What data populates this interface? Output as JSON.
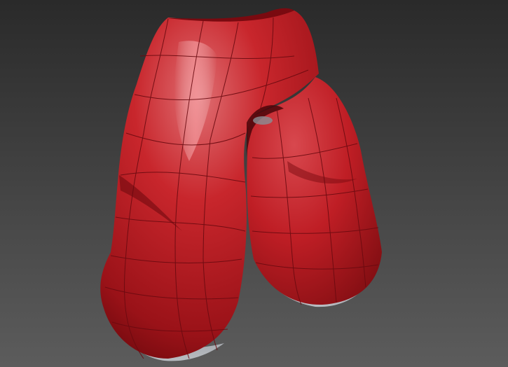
{
  "viewport": {
    "background_top": "#2a2a2a",
    "background_bottom": "#5c5c5c"
  },
  "model": {
    "object": "pants-mesh",
    "material_color": "#c8262c",
    "highlight_color": "#e88a8e",
    "shadow_color": "#5a0a0e",
    "wire_color": "#6a0a10",
    "underside_color": "#8a8f95"
  }
}
